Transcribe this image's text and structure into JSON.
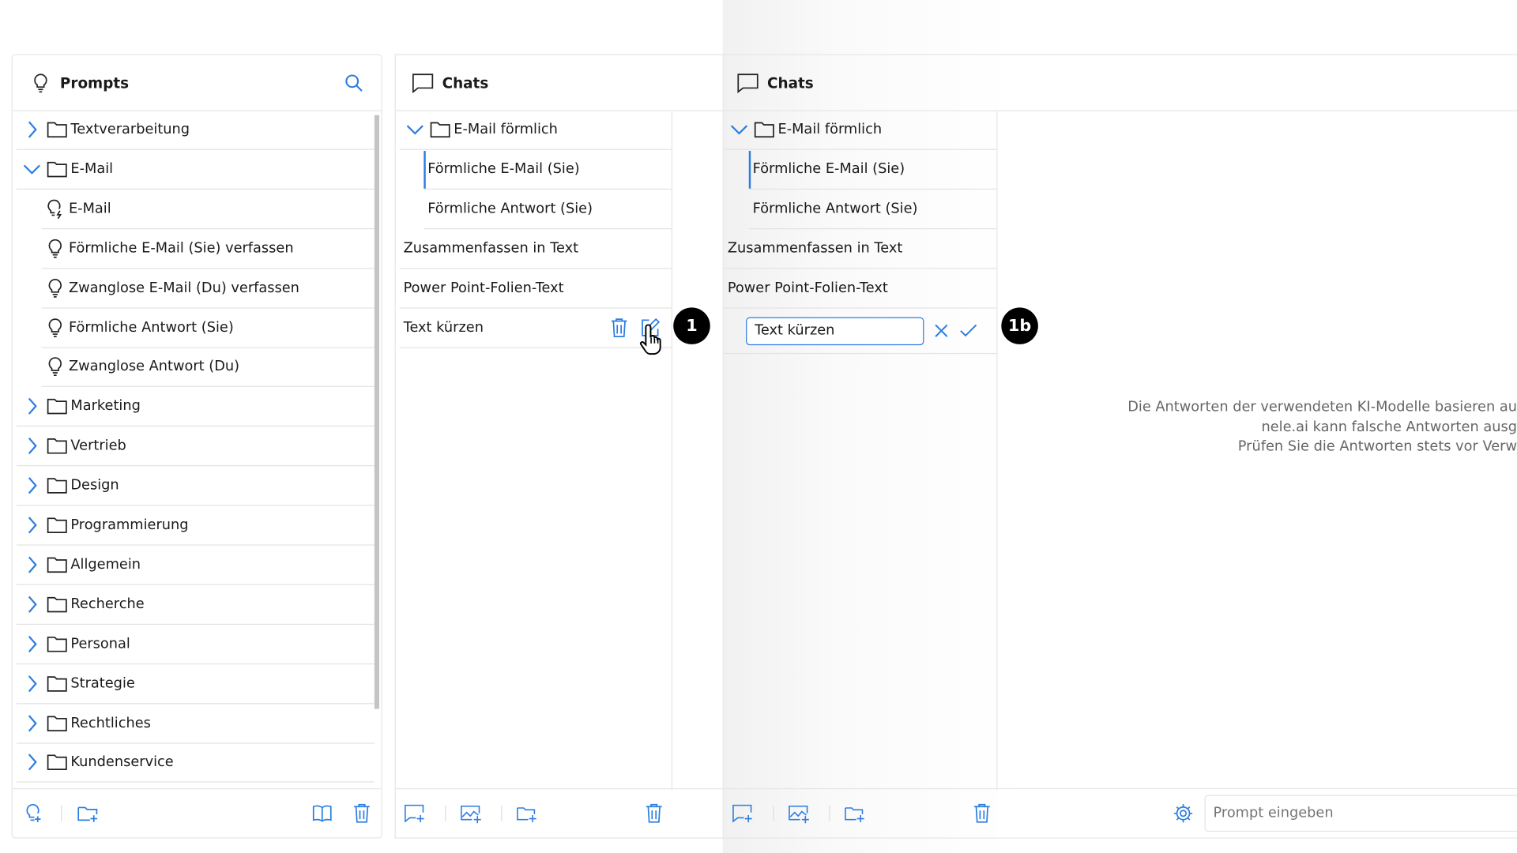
{
  "prompts_panel": {
    "title": "Prompts",
    "items": [
      {
        "type": "folder",
        "label": "Textverarbeitung",
        "expanded": false,
        "level": 0
      },
      {
        "type": "folder",
        "label": "E-Mail",
        "expanded": true,
        "level": 0
      },
      {
        "type": "prompt",
        "label": "E-Mail",
        "icon": "lightbulb-bolt-icon",
        "level": 1
      },
      {
        "type": "prompt",
        "label": "Förmliche E-Mail (Sie) verfassen",
        "icon": "lightbulb-icon",
        "level": 1
      },
      {
        "type": "prompt",
        "label": "Zwanglose E-Mail (Du) verfassen",
        "icon": "lightbulb-icon",
        "level": 1
      },
      {
        "type": "prompt",
        "label": "Förmliche Antwort (Sie)",
        "icon": "lightbulb-icon",
        "level": 1
      },
      {
        "type": "prompt",
        "label": "Zwanglose Antwort (Du)",
        "icon": "lightbulb-icon",
        "level": 1
      },
      {
        "type": "folder",
        "label": "Marketing",
        "expanded": false,
        "level": 0
      },
      {
        "type": "folder",
        "label": "Vertrieb",
        "expanded": false,
        "level": 0
      },
      {
        "type": "folder",
        "label": "Design",
        "expanded": false,
        "level": 0
      },
      {
        "type": "folder",
        "label": "Programmierung",
        "expanded": false,
        "level": 0
      },
      {
        "type": "folder",
        "label": "Allgemein",
        "expanded": false,
        "level": 0
      },
      {
        "type": "folder",
        "label": "Recherche",
        "expanded": false,
        "level": 0
      },
      {
        "type": "folder",
        "label": "Personal",
        "expanded": false,
        "level": 0
      },
      {
        "type": "folder",
        "label": "Strategie",
        "expanded": false,
        "level": 0
      },
      {
        "type": "folder",
        "label": "Rechtliches",
        "expanded": false,
        "level": 0
      },
      {
        "type": "folder",
        "label": "Kundenservice",
        "expanded": false,
        "level": 0
      }
    ]
  },
  "chats_panel_1": {
    "title": "Chats",
    "items": [
      {
        "type": "folder",
        "label": "E-Mail förmlich",
        "expanded": true,
        "level": 0
      },
      {
        "type": "chat",
        "label": "Förmliche E-Mail (Sie)",
        "level": 1,
        "active": true
      },
      {
        "type": "chat",
        "label": "Förmliche Antwort (Sie)",
        "level": 1
      },
      {
        "type": "chat",
        "label": "Zusammenfassen in Text",
        "level": 0
      },
      {
        "type": "chat",
        "label": "Power Point-Folien-Text",
        "level": 0
      },
      {
        "type": "chat",
        "label": "Text kürzen",
        "level": 0,
        "hover": true
      }
    ],
    "badge": "1"
  },
  "chats_panel_2": {
    "title": "Chats",
    "items": [
      {
        "type": "folder",
        "label": "E-Mail förmlich",
        "expanded": true,
        "level": 0
      },
      {
        "type": "chat",
        "label": "Förmliche E-Mail (Sie)",
        "level": 1,
        "active": true
      },
      {
        "type": "chat",
        "label": "Förmliche Antwort (Sie)",
        "level": 1
      },
      {
        "type": "chat",
        "label": "Zusammenfassen in Text",
        "level": 0
      },
      {
        "type": "chat",
        "label": "Power Point-Folien-Text",
        "level": 0
      }
    ],
    "rename_value": "Text kürzen",
    "badge": "1b",
    "disclaimer": [
      "Die Antworten der verwendeten KI-Modelle basieren au",
      "nele.ai kann falsche Antworten ausg",
      "Prüfen Sie die Antworten stets vor Verw"
    ],
    "prompt_placeholder": "Prompt eingeben"
  },
  "colors": {
    "accent": "#2a7de1",
    "border": "#e6e6e6",
    "badge": "#000000"
  }
}
